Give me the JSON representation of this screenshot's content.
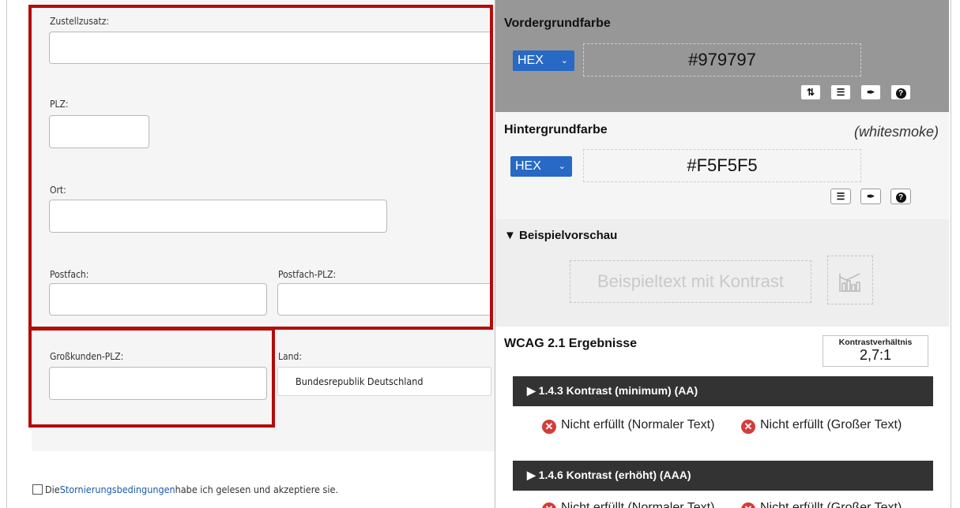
{
  "form": {
    "zustellzusatz_label": "Zustellzusatz:",
    "plz_label": "PLZ:",
    "ort_label": "Ort:",
    "postfach_label": "Postfach:",
    "postfach_plz_label": "Postfach-PLZ:",
    "grosskunden_plz_label": "Großkunden-PLZ:",
    "land_label": "Land:",
    "land_value": "Bundesrepublik Deutschland",
    "agree_prefix": "Die ",
    "agree_link": "Stornierungsbedingungen",
    "agree_suffix": " habe ich gelesen und akzeptiere sie."
  },
  "contrast_checker": {
    "foreground": {
      "title": "Vordergrundfarbe",
      "format": "HEX",
      "value": "#979797"
    },
    "background": {
      "title": "Hintergrundfarbe",
      "name": "(whitesmoke)",
      "format": "HEX",
      "value": "#F5F5F5"
    },
    "preview": {
      "title": "▼ Beispielvorschau",
      "sample_text": "Beispieltext mit Kontrast"
    },
    "results": {
      "title": "WCAG 2.1 Ergebnisse",
      "ratio_label": "Kontrastverhältnis",
      "ratio_value": "2,7:1",
      "criteria": [
        {
          "label": "▶ 1.4.3 Kontrast (minimum) (AA)",
          "normal": "Nicht erfüllt (Normaler Text)",
          "large": "Nicht erfüllt (Großer Text)"
        },
        {
          "label": "▶ 1.4.6 Kontrast (erhöht) (AAA)",
          "normal": "Nicht erfüllt (Normaler Text)",
          "large": "Nicht erfüllt (Großer Text)"
        }
      ]
    }
  },
  "colors": {
    "highlight_red": "#b50b0b",
    "foreground_swatch": "#979797",
    "background_swatch": "#F5F5F5",
    "select_blue": "#2769c4",
    "criteria_bar": "#333333",
    "fail_red": "#d63b3b"
  }
}
